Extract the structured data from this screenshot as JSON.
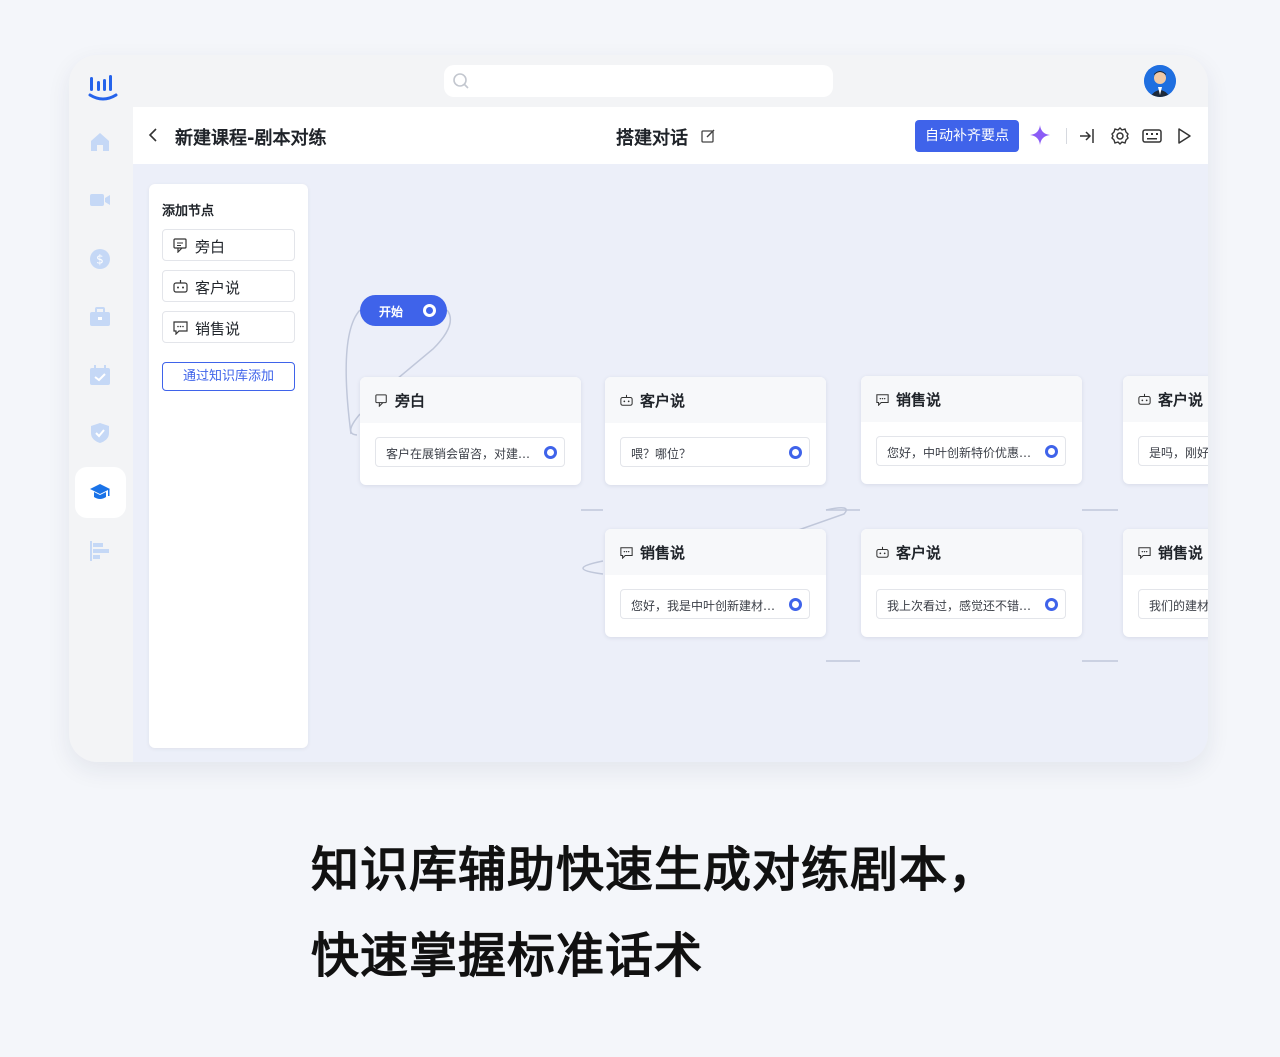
{
  "header": {
    "course_title": "新建课程-剧本对练",
    "center_title": "搭建对话",
    "auto_button": "自动补齐要点"
  },
  "panel": {
    "title": "添加节点",
    "nodes": [
      "旁白",
      "客户说",
      "销售说"
    ],
    "kb_button": "通过知识库添加"
  },
  "start_label": "开始",
  "cards": [
    {
      "title": "旁白",
      "text": "客户在展销会留咨，对建…"
    },
    {
      "title": "客户说",
      "text": "喂？哪位？"
    },
    {
      "title": "销售说",
      "text": "您好，中叶创新特价优惠…"
    },
    {
      "title": "客户说",
      "text": "是吗，刚好"
    },
    {
      "title": "销售说",
      "text": "您好，我是中叶创新建材…"
    },
    {
      "title": "客户说",
      "text": "我上次看过，感觉还不错…"
    },
    {
      "title": "销售说",
      "text": "我们的建材"
    }
  ],
  "caption": {
    "line1": "知识库辅助快速生成对练剧本，",
    "line2": "快速掌握标准话术"
  },
  "colors": {
    "accent": "#3f63ea",
    "sidebar_icon": "#c5d8f6",
    "sidebar_active": "#1a73e8",
    "canvas": "#eceff9"
  }
}
